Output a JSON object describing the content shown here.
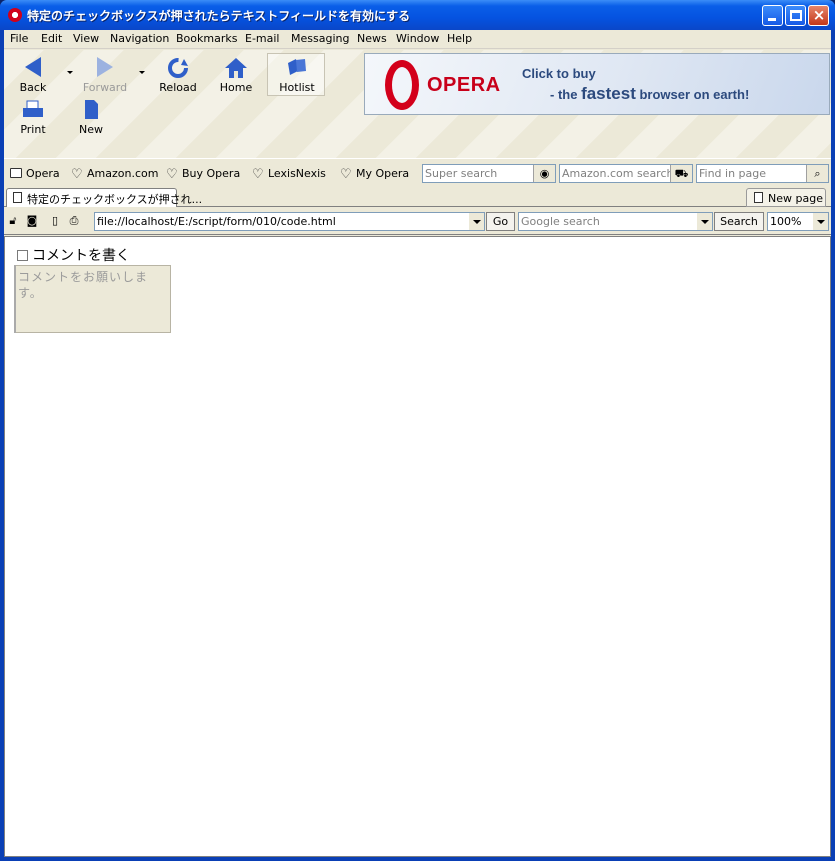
{
  "window": {
    "title": "特定のチェックボックスが押されたらテキストフィールドを有効にする"
  },
  "menu": {
    "items": [
      "File",
      "Edit",
      "View",
      "Navigation",
      "Bookmarks",
      "E-mail",
      "Messaging",
      "News",
      "Window",
      "Help"
    ]
  },
  "toolbar": {
    "back": "Back",
    "forward": "Forward",
    "reload": "Reload",
    "home": "Home",
    "hotlist": "Hotlist",
    "print": "Print",
    "new": "New"
  },
  "banner": {
    "logo": "OPERA",
    "line1": "Click to buy",
    "line2_prefix": "- the ",
    "line2_bold": "fastest",
    "line2_suffix": " browser on earth!"
  },
  "personal_bar": {
    "items": [
      "Opera",
      "Amazon.com",
      "Buy Opera",
      "LexisNexis",
      "My Opera"
    ],
    "super_search_placeholder": "Super search",
    "amazon_search_placeholder": "Amazon.com search",
    "find_placeholder": "Find in page"
  },
  "tabs": {
    "active_title": "特定のチェックボックスが押され...",
    "new_page": "New page"
  },
  "nav": {
    "address": "file://localhost/E:/script/form/010/code.html",
    "go": "Go",
    "google_placeholder": "Google search",
    "search": "Search",
    "zoom": "100%"
  },
  "content": {
    "checkbox_label": "コメントを書く",
    "checkbox_checked": false,
    "textarea_placeholder": "コメントをお願いします。",
    "textarea_enabled": false
  },
  "colors": {
    "titlebar": "#0553e0",
    "chrome": "#ece9d8",
    "opera_red": "#d3001b"
  }
}
